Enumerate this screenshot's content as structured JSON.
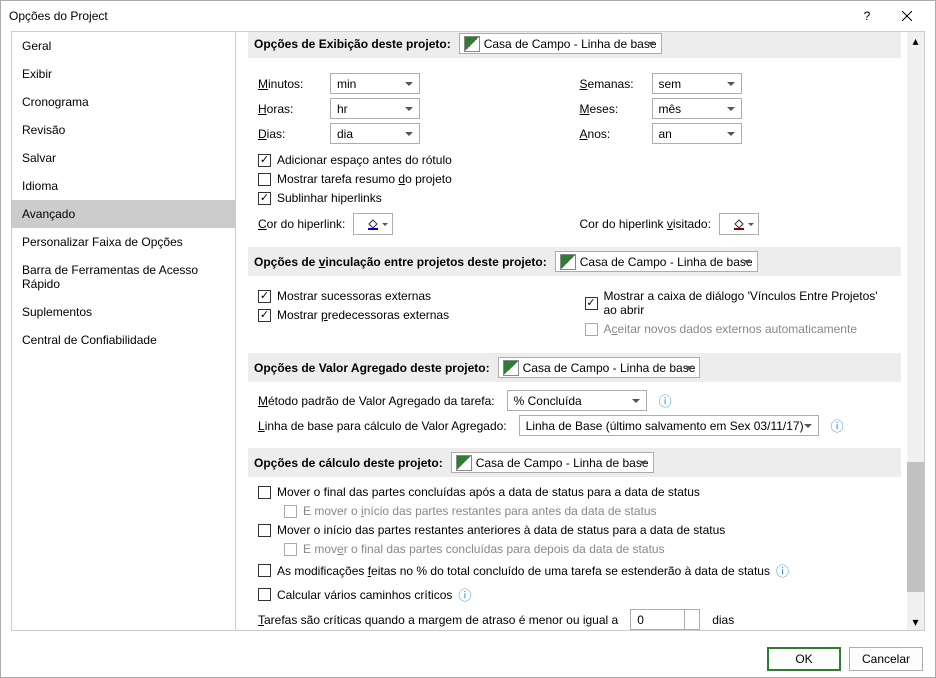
{
  "window": {
    "title": "Opções do Project"
  },
  "sidebar": {
    "items": [
      {
        "label": "Geral"
      },
      {
        "label": "Exibir"
      },
      {
        "label": "Cronograma"
      },
      {
        "label": "Revisão"
      },
      {
        "label": "Salvar"
      },
      {
        "label": "Idioma"
      },
      {
        "label": "Avançado"
      },
      {
        "label": "Personalizar Faixa de Opções"
      },
      {
        "label": "Barra de Ferramentas de Acesso Rápido"
      },
      {
        "label": "Suplementos"
      },
      {
        "label": "Central de Confiabilidade"
      }
    ],
    "selected": 6
  },
  "content": {
    "display_section": {
      "title": "Opções de Exibição deste projeto:",
      "project": "Casa de Campo - Linha de base",
      "labels": {
        "minutos": "Minutos:",
        "horas": "Horas:",
        "dias": "Dias:",
        "semanas": "Semanas:",
        "meses": "Meses:",
        "anos": "Anos:"
      },
      "values": {
        "minutos": "min",
        "horas": "hr",
        "dias": "dia",
        "semanas": "sem",
        "meses": "mês",
        "anos": "an"
      },
      "checks": {
        "add_space": "Adicionar espaço antes do rótulo",
        "show_summary": "Mostrar tarefa resumo do projeto",
        "underline_links": "Sublinhar hiperlinks"
      },
      "hyperlink_color": "Cor do hiperlink:",
      "visited_color": "Cor do hiperlink visitado:"
    },
    "link_section": {
      "title": "Opções de vinculação entre projetos deste projeto:",
      "project": "Casa de Campo - Linha de base",
      "checks": {
        "show_ext_succ": "Mostrar sucessoras externas",
        "show_ext_pred": "Mostrar predecessoras externas",
        "show_dialog": "Mostrar a caixa de diálogo 'Vínculos Entre Projetos' ao abrir",
        "auto_accept": "Aceitar novos dados externos automaticamente"
      }
    },
    "ev_section": {
      "title": "Opções de Valor Agregado deste projeto:",
      "project": "Casa de Campo - Linha de base",
      "method_label": "Método padrão de Valor Agregado da tarefa:",
      "method_value": "% Concluída",
      "baseline_label": "Linha de base para cálculo de Valor Agregado:",
      "baseline_value": "Linha de Base  (último salvamento em Sex 03/11/17)"
    },
    "calc_section": {
      "title": "Opções de cálculo deste projeto:",
      "project": "Casa de Campo - Linha de base",
      "checks": {
        "move_end": "Mover o final das partes concluídas após a data de status para a data de status",
        "and_move_start": "E mover o início das partes restantes para antes da data de status",
        "move_start": "Mover o início das partes restantes anteriores à data de status para a data de status",
        "and_move_end": "E mover o final das partes concluídas para depois da data de status",
        "edits_spread": "As modificações feitas no % do total concluído de uma tarefa se estenderão à data de status",
        "multi_critical": "Calcular vários caminhos críticos"
      },
      "slack_label_pre": "Tarefas são críticas quando a margem de atraso é menor ou igual a",
      "slack_value": "0",
      "slack_label_post": "dias"
    }
  },
  "footer": {
    "ok": "OK",
    "cancel": "Cancelar"
  }
}
